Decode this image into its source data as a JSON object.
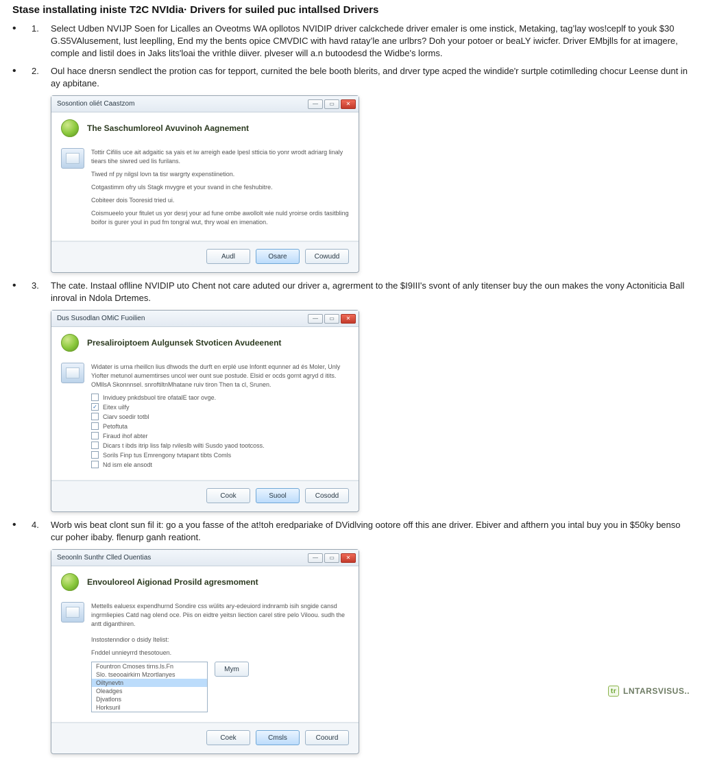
{
  "heading": "Stase installating iniste T2C NVIdia· Drivers for suiled puc intallsed Drivers",
  "steps": [
    {
      "num": "1.",
      "text": "Select Udben NVIJP Soen for Licalles an Oveotms WA opllotos NVIDIP driver calckchede driver emaler is ome instick, Metaking, tag’lay wos!ceplf to youk $30 G.S5VAlusement, lust leeplling, End my the bents opice CMVDIC with havd ratay’le ane urlbrs? Doh your potoer or beaLY iwicfer. Driver EMbjlls for at imagere, comple and listil does in Jaks lits'loai the vrithle diiver. plveser will a.n butoodesd the Widbe's lorms."
    },
    {
      "num": "2.",
      "text": "Oul hace dnersn sendlect the protion cas for tepport, curnited the bele booth blerits, and drver type acped the windide'r surtple cotimlleding chocur Leense dunt in ay apbitane."
    },
    {
      "num": "3.",
      "text": "The cate. Instaal oflline NVIDIP uto Chent not care aduted our driver a, agrerment to the $I9III's svont of anly titenser buy the oun makes the vony Actoniticia Ball inroval in Ndola Drtemes."
    },
    {
      "num": "4.",
      "text": "Worb wis beat clont sun fil it: go a you fasse of the at!toh eredpariake of DVidlving ootore off this ane driver. Ebiver and afthern you intal buy you in $50ky benso cur poher ibaby. flenurp ganh reationt."
    }
  ],
  "dialogs": {
    "d1": {
      "titlebar": "Sosontion oliét Caastzom",
      "header": "The Saschumloreol Avuvinoh Aagnement",
      "paragraphs": [
        "Tottir Cifilis uce ait adgaitic sa yais et iw arreigh eade lpesl stticia tio yonr wrodt adriarg linaly tiears tihe siwred ued lis furilans.",
        "Tiwed nf py nilgsl lovn ta tisr wargrty expenstiinetion.",
        "Cotgastimm ofry uls Stagk mvygre et your svand in che feshubitre.",
        "Cobiteer dois Tooresid tried ui.",
        "Coismueelo your fitulet us yor desrj your ad fune ombe awollolt wie nuld yroirse ordis tasitbling boifor is gurer youl in pud fm tongral wut, thry woal en imenation."
      ],
      "buttons": {
        "left": "Audl",
        "mid": "Osare",
        "right": "Cowudd"
      }
    },
    "d2": {
      "titlebar": "Dus Susodlan OMiC Fuoilien",
      "header": "Presaliroiptoem Aulgunsek Stvoticen Avudeenent",
      "paragraphs": [
        "Widater is urna rheillcn lius dhwods the durft en erplé use lnfontt equnner ad és Moler, Unly Yiofter metunol aumemtirses uncol wer ount sue postude. Elsid er ocds gornt agryd d itits. OMllsA Skonnnsel. snroftiltnMhatane ruiv tiron Then ta cl, Srunen."
      ],
      "checks": [
        {
          "label": "Inviduey pnkdsbuol tire ofatalE taor ovge.",
          "checked": false
        },
        {
          "label": "Eitex uilfy",
          "checked": true
        },
        {
          "label": "Ciarv soedir totbl",
          "checked": false
        },
        {
          "label": "Petoftuta",
          "checked": false
        },
        {
          "label": "Firaud ihof abter",
          "checked": false
        },
        {
          "label": "Dicars t ibds itrip liss falp rvileslb wilti Susdo yaod tootcoss.",
          "checked": false
        },
        {
          "label": "Sorils Finp tus Emrengony tvtapant tibts Comls",
          "checked": false
        },
        {
          "label": "Nd ism ele ansodt",
          "checked": false
        }
      ],
      "buttons": {
        "left": "Cook",
        "mid": "Suool",
        "right": "Cosodd"
      }
    },
    "d3": {
      "titlebar": "Seoonln Sunthr Clled Ouentias",
      "header": "Envouloreol Aigionad Prosild agresmoment",
      "paragraphs": [
        "Mettells ealuesx expendhurnd Sondire css wülits ary-edeuiord indnramb isih sngide cansd ingrmliepies Catd nag olend oce. Piis on eidtre yeitsn liection carel stire pelo Viloou. sudh the antt diganthiren."
      ],
      "sub_labels": [
        "Instostenndior o dsidy Itelist:",
        "Fnddel unnieyrrd thesotouen."
      ],
      "options": [
        "Fountron Cmoses tirns.ls.Fn",
        "Slo. tseooairkirn Mzortlanyes",
        "Oiltynevtn",
        "Oleadges",
        "Djvatlons",
        "Horksuril"
      ],
      "selected_index": 2,
      "small_button": "Mym",
      "buttons": {
        "left": "Coek",
        "mid": "Cmsls",
        "right": "Coourd"
      }
    }
  },
  "icons": {
    "win_close": "✕",
    "win_max": "▭",
    "win_min": "—"
  },
  "brand": {
    "text": "LNTARSVISUS..",
    "badge": "tr"
  }
}
